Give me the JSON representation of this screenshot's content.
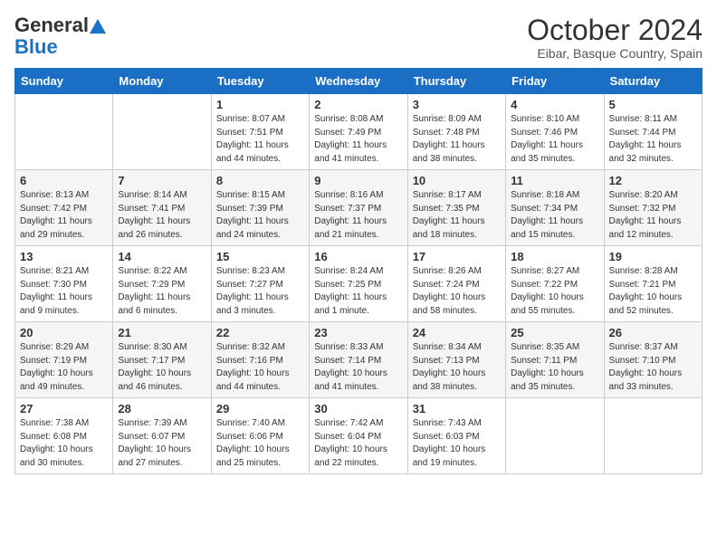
{
  "header": {
    "logo_general": "General",
    "logo_blue": "Blue",
    "month_title": "October 2024",
    "subtitle": "Eibar, Basque Country, Spain"
  },
  "days_of_week": [
    "Sunday",
    "Monday",
    "Tuesday",
    "Wednesday",
    "Thursday",
    "Friday",
    "Saturday"
  ],
  "weeks": [
    [
      {
        "day": "",
        "info": ""
      },
      {
        "day": "",
        "info": ""
      },
      {
        "day": "1",
        "info": "Sunrise: 8:07 AM\nSunset: 7:51 PM\nDaylight: 11 hours and 44 minutes."
      },
      {
        "day": "2",
        "info": "Sunrise: 8:08 AM\nSunset: 7:49 PM\nDaylight: 11 hours and 41 minutes."
      },
      {
        "day": "3",
        "info": "Sunrise: 8:09 AM\nSunset: 7:48 PM\nDaylight: 11 hours and 38 minutes."
      },
      {
        "day": "4",
        "info": "Sunrise: 8:10 AM\nSunset: 7:46 PM\nDaylight: 11 hours and 35 minutes."
      },
      {
        "day": "5",
        "info": "Sunrise: 8:11 AM\nSunset: 7:44 PM\nDaylight: 11 hours and 32 minutes."
      }
    ],
    [
      {
        "day": "6",
        "info": "Sunrise: 8:13 AM\nSunset: 7:42 PM\nDaylight: 11 hours and 29 minutes."
      },
      {
        "day": "7",
        "info": "Sunrise: 8:14 AM\nSunset: 7:41 PM\nDaylight: 11 hours and 26 minutes."
      },
      {
        "day": "8",
        "info": "Sunrise: 8:15 AM\nSunset: 7:39 PM\nDaylight: 11 hours and 24 minutes."
      },
      {
        "day": "9",
        "info": "Sunrise: 8:16 AM\nSunset: 7:37 PM\nDaylight: 11 hours and 21 minutes."
      },
      {
        "day": "10",
        "info": "Sunrise: 8:17 AM\nSunset: 7:35 PM\nDaylight: 11 hours and 18 minutes."
      },
      {
        "day": "11",
        "info": "Sunrise: 8:18 AM\nSunset: 7:34 PM\nDaylight: 11 hours and 15 minutes."
      },
      {
        "day": "12",
        "info": "Sunrise: 8:20 AM\nSunset: 7:32 PM\nDaylight: 11 hours and 12 minutes."
      }
    ],
    [
      {
        "day": "13",
        "info": "Sunrise: 8:21 AM\nSunset: 7:30 PM\nDaylight: 11 hours and 9 minutes."
      },
      {
        "day": "14",
        "info": "Sunrise: 8:22 AM\nSunset: 7:29 PM\nDaylight: 11 hours and 6 minutes."
      },
      {
        "day": "15",
        "info": "Sunrise: 8:23 AM\nSunset: 7:27 PM\nDaylight: 11 hours and 3 minutes."
      },
      {
        "day": "16",
        "info": "Sunrise: 8:24 AM\nSunset: 7:25 PM\nDaylight: 11 hours and 1 minute."
      },
      {
        "day": "17",
        "info": "Sunrise: 8:26 AM\nSunset: 7:24 PM\nDaylight: 10 hours and 58 minutes."
      },
      {
        "day": "18",
        "info": "Sunrise: 8:27 AM\nSunset: 7:22 PM\nDaylight: 10 hours and 55 minutes."
      },
      {
        "day": "19",
        "info": "Sunrise: 8:28 AM\nSunset: 7:21 PM\nDaylight: 10 hours and 52 minutes."
      }
    ],
    [
      {
        "day": "20",
        "info": "Sunrise: 8:29 AM\nSunset: 7:19 PM\nDaylight: 10 hours and 49 minutes."
      },
      {
        "day": "21",
        "info": "Sunrise: 8:30 AM\nSunset: 7:17 PM\nDaylight: 10 hours and 46 minutes."
      },
      {
        "day": "22",
        "info": "Sunrise: 8:32 AM\nSunset: 7:16 PM\nDaylight: 10 hours and 44 minutes."
      },
      {
        "day": "23",
        "info": "Sunrise: 8:33 AM\nSunset: 7:14 PM\nDaylight: 10 hours and 41 minutes."
      },
      {
        "day": "24",
        "info": "Sunrise: 8:34 AM\nSunset: 7:13 PM\nDaylight: 10 hours and 38 minutes."
      },
      {
        "day": "25",
        "info": "Sunrise: 8:35 AM\nSunset: 7:11 PM\nDaylight: 10 hours and 35 minutes."
      },
      {
        "day": "26",
        "info": "Sunrise: 8:37 AM\nSunset: 7:10 PM\nDaylight: 10 hours and 33 minutes."
      }
    ],
    [
      {
        "day": "27",
        "info": "Sunrise: 7:38 AM\nSunset: 6:08 PM\nDaylight: 10 hours and 30 minutes."
      },
      {
        "day": "28",
        "info": "Sunrise: 7:39 AM\nSunset: 6:07 PM\nDaylight: 10 hours and 27 minutes."
      },
      {
        "day": "29",
        "info": "Sunrise: 7:40 AM\nSunset: 6:06 PM\nDaylight: 10 hours and 25 minutes."
      },
      {
        "day": "30",
        "info": "Sunrise: 7:42 AM\nSunset: 6:04 PM\nDaylight: 10 hours and 22 minutes."
      },
      {
        "day": "31",
        "info": "Sunrise: 7:43 AM\nSunset: 6:03 PM\nDaylight: 10 hours and 19 minutes."
      },
      {
        "day": "",
        "info": ""
      },
      {
        "day": "",
        "info": ""
      }
    ]
  ]
}
